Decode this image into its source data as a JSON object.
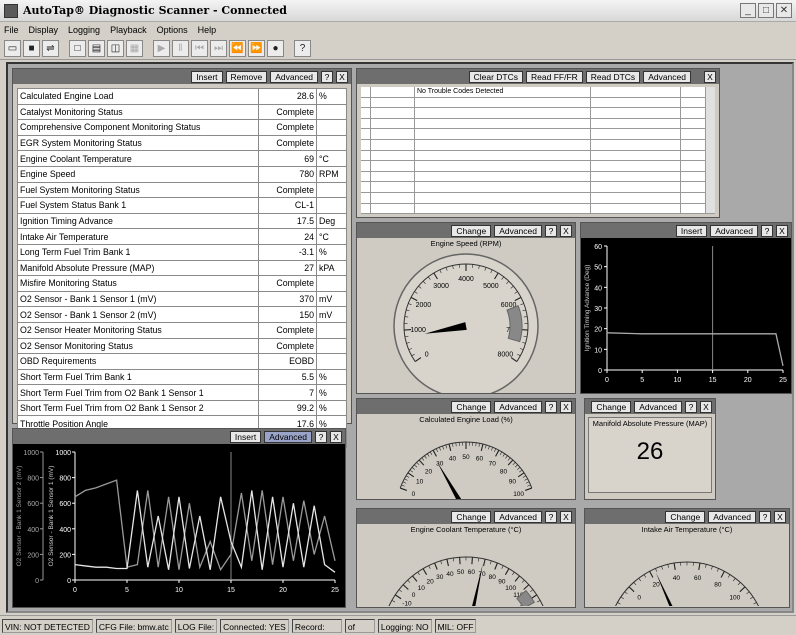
{
  "window": {
    "title": "AutoTap® Diagnostic Scanner - Connected"
  },
  "menu": [
    "File",
    "Display",
    "Logging",
    "Playback",
    "Options",
    "Help"
  ],
  "pid_panel": {
    "buttons": {
      "insert": "Insert",
      "remove": "Remove",
      "advanced": "Advanced",
      "help": "?",
      "close": "X"
    },
    "rows": [
      {
        "name": "Calculated Engine Load",
        "value": "28.6",
        "unit": "%"
      },
      {
        "name": "Catalyst Monitoring Status",
        "value": "Complete",
        "unit": ""
      },
      {
        "name": "Comprehensive Component Monitoring Status",
        "value": "Complete",
        "unit": ""
      },
      {
        "name": "EGR System Monitoring Status",
        "value": "Complete",
        "unit": ""
      },
      {
        "name": "Engine Coolant Temperature",
        "value": "69",
        "unit": "°C"
      },
      {
        "name": "Engine Speed",
        "value": "780",
        "unit": "RPM"
      },
      {
        "name": "Fuel System Monitoring Status",
        "value": "Complete",
        "unit": ""
      },
      {
        "name": "Fuel System Status Bank 1",
        "value": "CL-1",
        "unit": ""
      },
      {
        "name": "Ignition Timing Advance",
        "value": "17.5",
        "unit": "Deg"
      },
      {
        "name": "Intake Air Temperature",
        "value": "24",
        "unit": "°C"
      },
      {
        "name": "Long Term Fuel Trim Bank 1",
        "value": "-3.1",
        "unit": "%"
      },
      {
        "name": "Manifold Absolute Pressure (MAP)",
        "value": "27",
        "unit": "kPA"
      },
      {
        "name": "Misfire Monitoring Status",
        "value": "Complete",
        "unit": ""
      },
      {
        "name": "O2 Sensor - Bank 1 Sensor 1 (mV)",
        "value": "370",
        "unit": "mV"
      },
      {
        "name": "O2 Sensor - Bank 1 Sensor 2 (mV)",
        "value": "150",
        "unit": "mV"
      },
      {
        "name": "O2 Sensor Heater Monitoring Status",
        "value": "Complete",
        "unit": ""
      },
      {
        "name": "O2 Sensor Monitoring Status",
        "value": "Complete",
        "unit": ""
      },
      {
        "name": "OBD Requirements",
        "value": "EOBD",
        "unit": ""
      },
      {
        "name": "Short Term Fuel Trim Bank 1",
        "value": "5.5",
        "unit": "%"
      },
      {
        "name": "Short Term Fuel Trim from O2 Bank 1 Sensor 1",
        "value": "7",
        "unit": "%"
      },
      {
        "name": "Short Term Fuel Trim from O2 Bank 1 Sensor 2",
        "value": "99.2",
        "unit": "%"
      },
      {
        "name": "Throttle Position Angle",
        "value": "17.6",
        "unit": "%"
      },
      {
        "name": "Vehicle Speed",
        "value": "0",
        "unit": "MPH"
      }
    ]
  },
  "dtc_panel": {
    "buttons": {
      "clear": "Clear DTCs",
      "readff": "Read FF/FR",
      "read": "Read DTCs",
      "advanced": "Advanced",
      "close": "X"
    },
    "message": "No Trouble Codes Detected"
  },
  "rpm_gauge": {
    "buttons": {
      "change": "Change",
      "advanced": "Advanced",
      "help": "?",
      "close": "X"
    },
    "title": "Engine Speed (RPM)",
    "ticks": [
      "0",
      "1000",
      "2000",
      "3000",
      "4000",
      "5000",
      "6000",
      "7000",
      "8000"
    ],
    "value": 780
  },
  "timing_plot": {
    "buttons": {
      "insert": "Insert",
      "advanced": "Advanced",
      "help": "?",
      "close": "X"
    },
    "ylabel": "Ignition Timing Advance (Deg)",
    "yticks": [
      "0",
      "10",
      "20",
      "30",
      "40",
      "50",
      "60"
    ],
    "xticks": [
      "0",
      "5",
      "10",
      "15",
      "20",
      "25"
    ]
  },
  "load_gauge": {
    "buttons": {
      "change": "Change",
      "advanced": "Advanced",
      "help": "?",
      "close": "X"
    },
    "title": "Calculated Engine Load  (%)",
    "ticks": [
      "0",
      "10",
      "20",
      "30",
      "40",
      "50",
      "60",
      "70",
      "80",
      "90",
      "100"
    ],
    "value": 28.6
  },
  "map_display": {
    "buttons": {
      "change": "Change",
      "advanced": "Advanced",
      "help": "?",
      "close": "X"
    },
    "title": "Manifold Absolute Pressure (MAP)",
    "value": "26"
  },
  "o2_plot": {
    "buttons": {
      "insert": "Insert",
      "advanced": "Advanced",
      "help": "?",
      "close": "X"
    },
    "ylabel1": "O2 Sensor - Bank 1 Sensor 2 (mV)",
    "ylabel2": "O2 Sensor - Bank 1 Sensor 1 (mV)",
    "yticks": [
      "0",
      "200",
      "400",
      "600",
      "800",
      "1000"
    ],
    "xticks": [
      "0",
      "5",
      "10",
      "15",
      "20",
      "25"
    ]
  },
  "coolant_gauge": {
    "buttons": {
      "change": "Change",
      "advanced": "Advanced",
      "help": "?",
      "close": "X"
    },
    "title": "Engine Coolant Temperature  (°C)",
    "ticks": [
      "-20",
      "-10",
      "0",
      "10",
      "20",
      "30",
      "40",
      "50",
      "60",
      "70",
      "80",
      "90",
      "100",
      "110",
      "120",
      "130"
    ],
    "value": 69
  },
  "intake_gauge": {
    "buttons": {
      "change": "Change",
      "advanced": "Advanced",
      "help": "?",
      "close": "X"
    },
    "title": "Intake Air Temperature  (°C)",
    "ticks": [
      "-20",
      "0",
      "20",
      "40",
      "60",
      "80",
      "100",
      "120"
    ],
    "value": 24
  },
  "chart_data": [
    {
      "type": "line",
      "ylabel": "Ignition Timing Advance (Deg)",
      "xlim": [
        0,
        25
      ],
      "ylim": [
        0,
        60
      ],
      "series": [
        {
          "x": [
            0,
            5,
            10,
            15,
            20,
            24,
            25
          ],
          "values": [
            18,
            17.5,
            17.5,
            17.5,
            17.5,
            17.5,
            2
          ]
        }
      ]
    },
    {
      "type": "line",
      "xlim": [
        0,
        25
      ],
      "ylim": [
        0,
        1000
      ],
      "series": [
        {
          "name": "O2 Sensor - Bank 1 Sensor 1 (mV)",
          "x": [
            0,
            1,
            2,
            3,
            4,
            5,
            6,
            7,
            8,
            9,
            10,
            11,
            12,
            13,
            14,
            15,
            16,
            17,
            18,
            19,
            20,
            21,
            22,
            23,
            24,
            25
          ],
          "values": [
            650,
            700,
            720,
            750,
            780,
            100,
            120,
            700,
            100,
            650,
            80,
            600,
            100,
            300,
            80,
            200,
            680,
            150,
            700,
            120,
            650,
            150,
            620,
            200,
            500,
            150
          ]
        },
        {
          "name": "O2 Sensor - Bank 1 Sensor 2 (mV)",
          "x": [
            0,
            1,
            2,
            3,
            4,
            5,
            6,
            7,
            8,
            9,
            10,
            11,
            12,
            13,
            14,
            15,
            16,
            17,
            18,
            19,
            20,
            21,
            22,
            23,
            24,
            25
          ],
          "values": [
            120,
            110,
            100,
            100,
            90,
            90,
            700,
            100,
            500,
            80,
            650,
            90,
            500,
            80,
            650,
            300,
            100,
            700,
            80,
            650,
            100,
            600,
            100,
            580,
            120,
            60
          ]
        }
      ]
    }
  ],
  "status": {
    "vin": "VIN: NOT DETECTED",
    "cfg": "CFG File: bmw.atc",
    "log": "LOG File:",
    "connected": "Connected: YES",
    "record": "Record:",
    "of": "of",
    "logging": "Logging: NO",
    "mil": "MIL: OFF"
  }
}
